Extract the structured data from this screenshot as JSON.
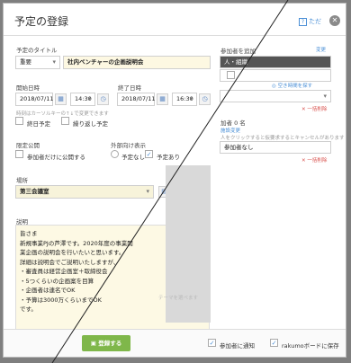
{
  "dialog": {
    "title": "予定の登録",
    "help_label": "ただ",
    "close_icon": "close-icon"
  },
  "schedule_title": {
    "label": "予定のタイトル",
    "category_value": "重要",
    "title_value": "社内ベンチャーの企画説明会"
  },
  "start": {
    "label": "開始日時",
    "date": "2018/07/11",
    "time": "14:30"
  },
  "end": {
    "label": "終了日時",
    "date": "2018/07/11",
    "time": "16:30"
  },
  "date_hint": "時刻はカーソルキーの↑↓で変更できます",
  "options": {
    "all_day": "終日予定",
    "repeat": "繰り返し予定"
  },
  "visibility": {
    "label": "限定公開",
    "only_participants": "参加者だけに公開する"
  },
  "external": {
    "label": "外部向け表示",
    "none": "予定なし",
    "exists": "予定あり"
  },
  "place": {
    "label": "場所",
    "value": "第三会議室"
  },
  "memo": {
    "label": "説明",
    "lines": [
      "皆さま",
      "新規事業PJの芦澤です。2020年度の事業開",
      "業企画の説明会を行いたいと思います。",
      "詳細は説明会でご説明いたしますが、",
      "・審査員は経営企画室＋取締役会",
      "・5つくらいの企画案を目算",
      "・企画者は連名でOK",
      "・予算は3000万くらいまでOK",
      "です。"
    ],
    "faded_text": "テーマを選べます"
  },
  "participants": {
    "label": "参加者を追加",
    "change_link": "変更",
    "tab_people": "人・組織",
    "search_link_1": "空き時間を探す",
    "delete_link_1": "一括削除",
    "facility_label": "加者 0 名",
    "facility_change": "施設変更",
    "facility_hint": "人をクリックすると仮要求するとキャンセルがあります",
    "none_label": "参加者なし",
    "delete_link_2": "一括削除"
  },
  "footer": {
    "save_label": "登録する",
    "notify_label": "参加者に通知",
    "board_label": "rakumoボードに保存"
  },
  "colors": {
    "accent_blue": "#4a8fd6",
    "save_green": "#7fb74a",
    "title_bg": "#fdf8e2"
  }
}
